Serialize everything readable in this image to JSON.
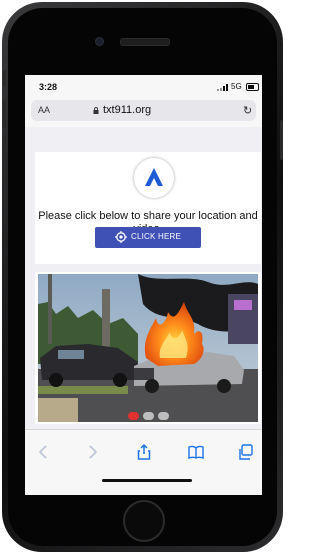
{
  "status_bar": {
    "time": "3:28",
    "network": "5G"
  },
  "browser": {
    "text_size_label": "AA",
    "url": "txt911.org",
    "icons": {
      "lock": "lock-icon",
      "reload": "reload-icon"
    }
  },
  "page": {
    "logo": "txt911-logo",
    "prompt": "Please click below to share your location and video.",
    "button_label": "CLICK HERE",
    "button_color": "#3f51b5",
    "video": {
      "description": "car-fire",
      "controls": [
        "record-icon",
        "stop-icon",
        "camera-icon"
      ]
    }
  },
  "toolbar": {
    "items": [
      "back-icon",
      "forward-icon",
      "share-icon",
      "bookmarks-icon",
      "tabs-icon"
    ]
  },
  "colors": {
    "accent": "#3f51b5",
    "toolbar_icon": "#1a73e8"
  }
}
